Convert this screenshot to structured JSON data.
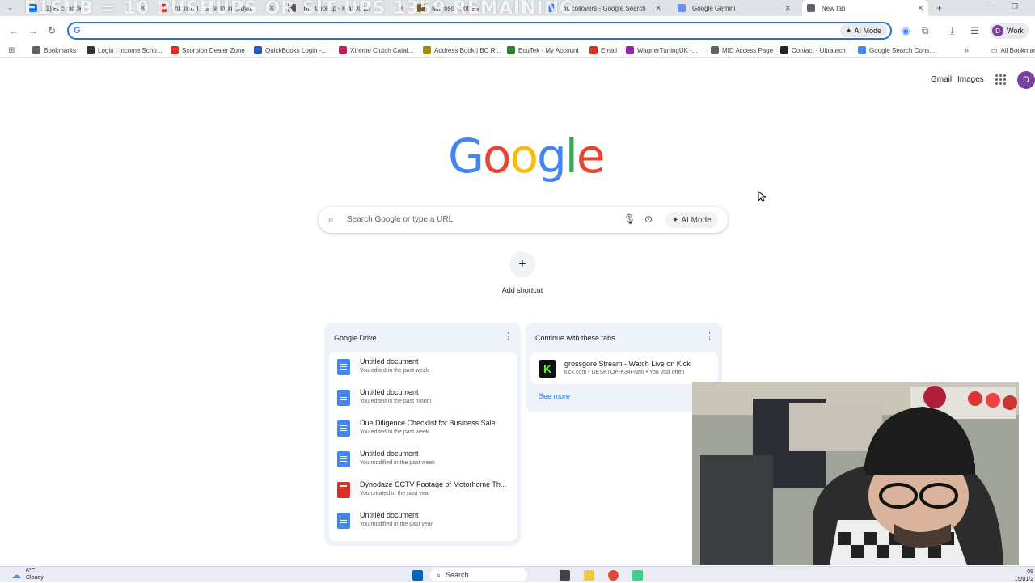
{
  "overlay_text": "F1SUB = 10 PUSHUPS OR SIT UPS 1359 REMAINING",
  "tabs": [
    {
      "title": "(1) Facebook",
      "color": "#1877f2"
    },
    {
      "title": "Inbox (1) - danielhunt@dyn...",
      "color": "#d93025"
    },
    {
      "title": "Tire Lookup - Kia Outlet",
      "color": "#555555"
    },
    {
      "title": "Microsoft Lottery",
      "color": "#7a5c2e"
    },
    {
      "title": "bc coilovers - Google Search",
      "color": "#4285f4"
    },
    {
      "title": "Google Gemini",
      "color": "#6b8ff0"
    },
    {
      "title": "New tab",
      "color": "#5f6368",
      "active": true
    }
  ],
  "omnibox": {
    "ai_label": "AI Mode"
  },
  "profile": {
    "initial": "D",
    "label": "Work"
  },
  "bookmarks": [
    {
      "label": "Bookmarks",
      "color": "#5f6368"
    },
    {
      "label": "Login | Income Scho...",
      "color": "#333333"
    },
    {
      "label": "Scorpion Dealer Zone",
      "color": "#d93025"
    },
    {
      "label": "QuickBooks Login -...",
      "color": "#2b55c6"
    },
    {
      "label": "Xtreme Clutch Catal...",
      "color": "#c2185b"
    },
    {
      "label": "Address Book | BC R...",
      "color": "#9e8b00"
    },
    {
      "label": "EcuTek - My Account",
      "color": "#2e7d32"
    },
    {
      "label": "Email",
      "color": "#d93025"
    },
    {
      "label": "WagnerTuningUK -...",
      "color": "#8e24aa"
    },
    {
      "label": "MID Access Page",
      "color": "#5f6368"
    },
    {
      "label": "Contact - Ultratech",
      "color": "#222222"
    },
    {
      "label": "Google Search Cons...",
      "color": "#4285f4"
    }
  ],
  "all_bookmarks": "All Bookmarks",
  "header": {
    "gmail": "Gmail",
    "images": "Images",
    "avatar": "D"
  },
  "logo_letters": [
    {
      "ch": "G",
      "color": "#4285f4"
    },
    {
      "ch": "o",
      "color": "#ea4335"
    },
    {
      "ch": "o",
      "color": "#fbbc05"
    },
    {
      "ch": "g",
      "color": "#4285f4"
    },
    {
      "ch": "l",
      "color": "#34a853"
    },
    {
      "ch": "e",
      "color": "#ea4335"
    }
  ],
  "search": {
    "placeholder": "Search Google or type a URL",
    "ai_label": "AI Mode"
  },
  "shortcut": {
    "label": "Add shortcut"
  },
  "drive_card": {
    "title": "Google Drive",
    "items": [
      {
        "name": "Untitled document",
        "sub": "You edited in the past week",
        "type": "doc"
      },
      {
        "name": "Untitled document",
        "sub": "You edited in the past month",
        "type": "doc"
      },
      {
        "name": "Due Diligence Checklist for Business Sale",
        "sub": "You edited in the past week",
        "type": "doc"
      },
      {
        "name": "Untitled document",
        "sub": "You modified in the past week",
        "type": "doc"
      },
      {
        "name": "Dynodaze CCTV Footage of Motorhome Th...",
        "sub": "You created in the past year",
        "type": "video"
      },
      {
        "name": "Untitled document",
        "sub": "You modified in the past year",
        "type": "doc"
      }
    ]
  },
  "tabs_card": {
    "title": "Continue with these tabs",
    "item": {
      "name": "grossgore Stream - Watch Live on Kick",
      "sub": "kick.com • DESKTOP-K34FNMI • You visit often"
    },
    "see_more": "See more"
  },
  "taskbar": {
    "temp": "6°C",
    "condition": "Cloudy",
    "search": "Search",
    "time": "09",
    "date": "15/01/2"
  }
}
